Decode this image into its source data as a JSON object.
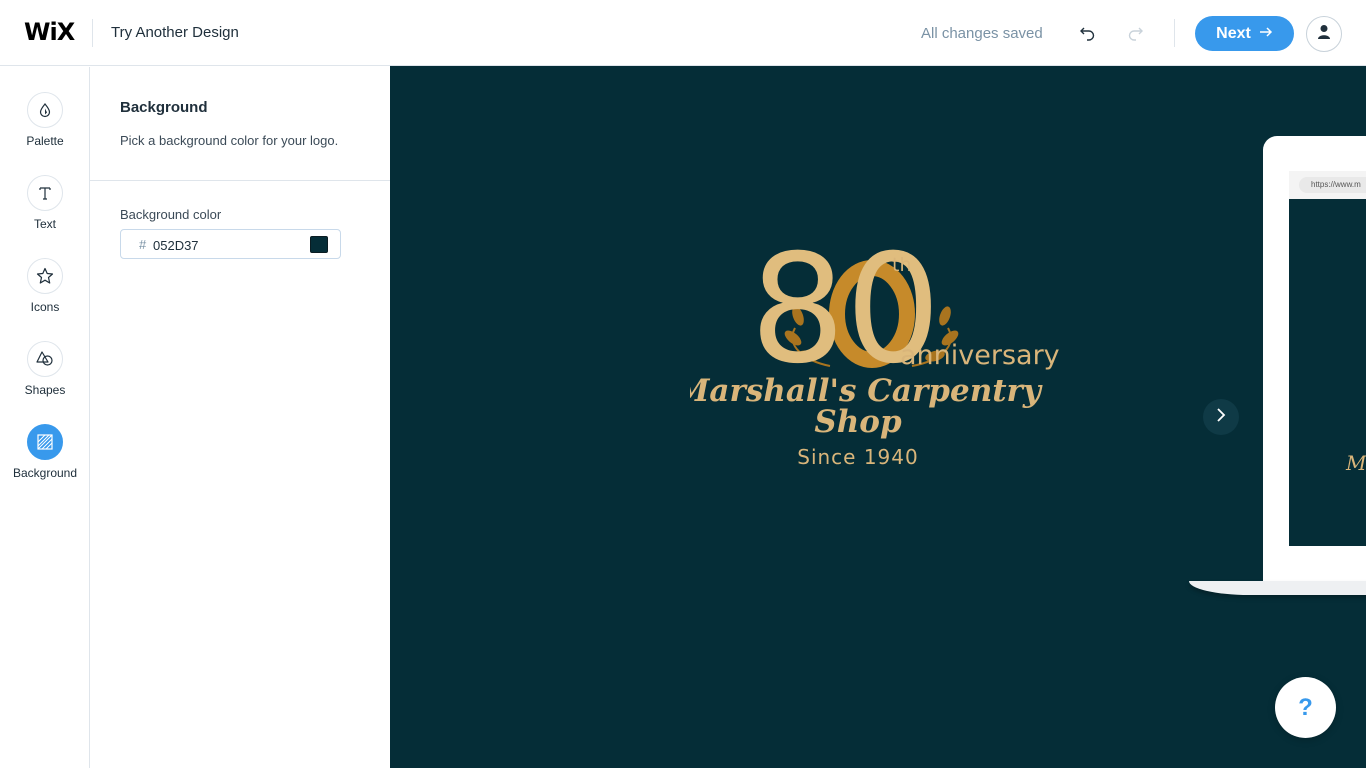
{
  "header": {
    "brand": "WiX",
    "try_another": "Try Another Design",
    "status": "All changes saved",
    "next_label": "Next"
  },
  "sidebar": {
    "items": [
      {
        "label": "Palette",
        "icon": "drop-icon"
      },
      {
        "label": "Text",
        "icon": "text-t-icon"
      },
      {
        "label": "Icons",
        "icon": "star-icon"
      },
      {
        "label": "Shapes",
        "icon": "shapes-icon"
      },
      {
        "label": "Background",
        "icon": "background-icon",
        "active": true
      }
    ]
  },
  "panel": {
    "title": "Background",
    "description": "Pick a background color for your logo.",
    "field_label": "Background color",
    "hash": "#",
    "color_value": "052D37"
  },
  "logo_preview": {
    "number": "80",
    "superscript": "th",
    "word": "anniversary",
    "name_line1": "Marshall's Carpentry",
    "name_line2": "Shop",
    "tagline": "Since 1940"
  },
  "mockup": {
    "url": "https://www.m",
    "mini_text": "M"
  },
  "help": {
    "label": "?"
  },
  "colors": {
    "accent": "#3899ec",
    "canvas_background": "#052D37",
    "logo_gold": "#d9b57a",
    "logo_gold_dark": "#c68a2a"
  }
}
